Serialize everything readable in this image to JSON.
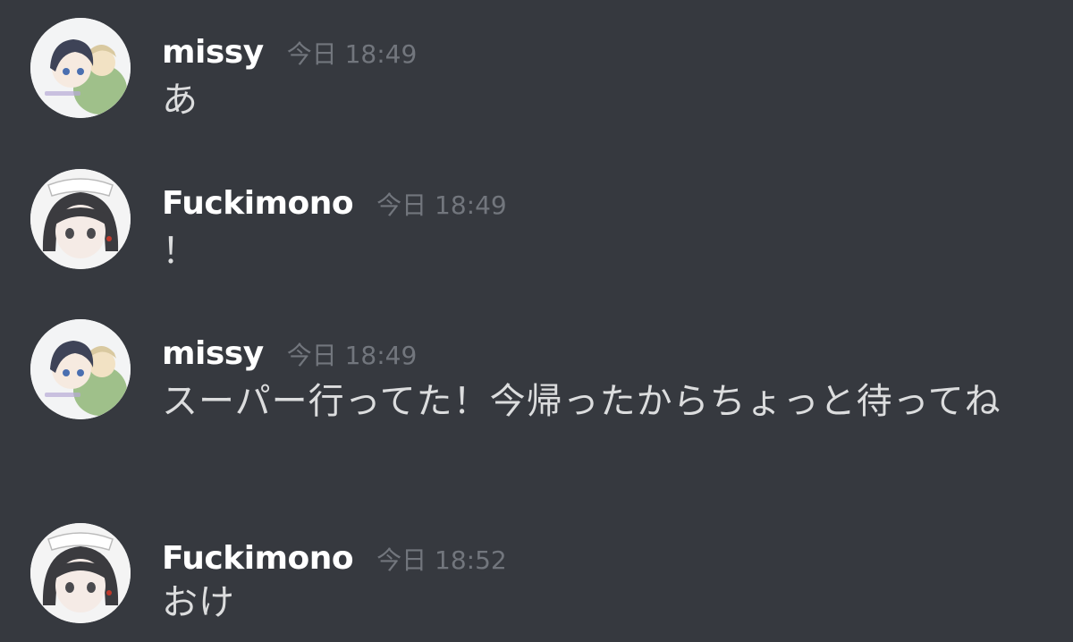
{
  "messages": [
    {
      "author": "missy",
      "avatar": "missy-avatar",
      "time": "今日 18:49",
      "text": "あ"
    },
    {
      "author": "Fuckimono",
      "avatar": "fuckimono-avatar",
      "time": "今日 18:49",
      "text": "！"
    },
    {
      "author": "missy",
      "avatar": "missy-avatar",
      "time": "今日 18:49",
      "text": "スーパー行ってた！今帰ったからちょっと待ってね"
    },
    {
      "author": "Fuckimono",
      "avatar": "fuckimono-avatar",
      "time": "今日 18:52",
      "text": "おけ"
    }
  ],
  "colors": {
    "background": "#36393f",
    "username": "#ffffff",
    "timestamp": "#72767d",
    "message_text": "#dcddde"
  }
}
